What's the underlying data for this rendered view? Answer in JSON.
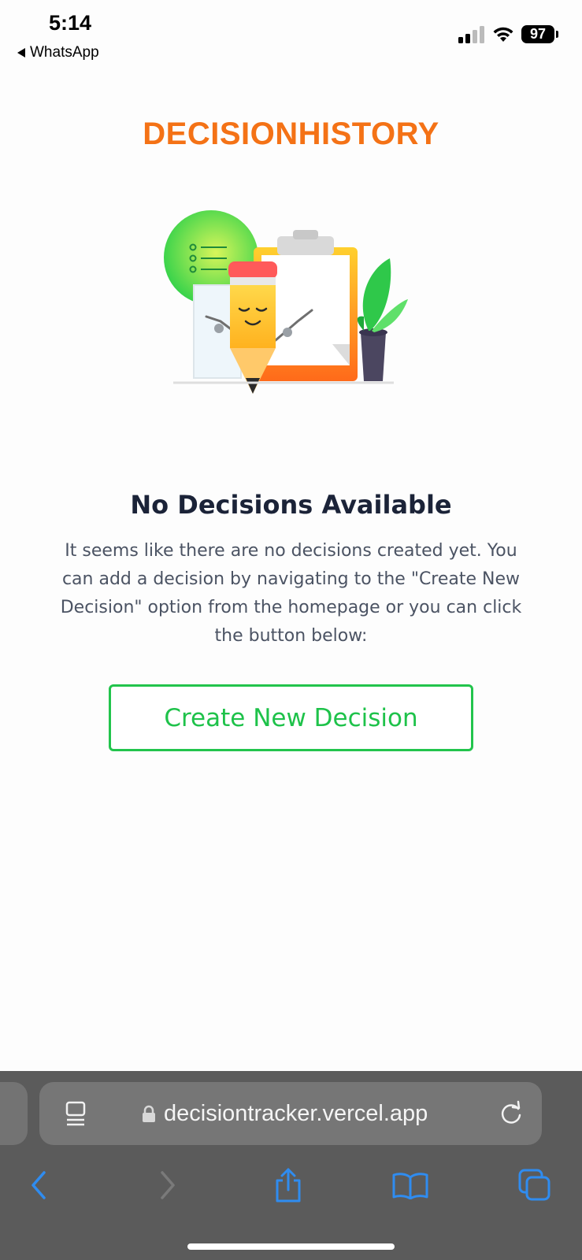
{
  "status_bar": {
    "time": "5:14",
    "back_app": "WhatsApp",
    "battery_level": "97"
  },
  "header": {
    "brand": "DECISIONHISTORY",
    "brand_color": "#f47216"
  },
  "empty_state": {
    "title": "No Decisions Available",
    "description": "It seems like there are no decisions created yet. You can add a decision by navigating to the \"Create New Decision\" option from the homepage or you can click the button below:",
    "button_label": "Create New Decision",
    "button_color": "#22c44c",
    "illustration": "pencil-clipboard-illustration"
  },
  "browser": {
    "url": "decisiontracker.vercel.app",
    "icons": [
      "reader-icon",
      "lock-icon",
      "reload-icon",
      "back-icon",
      "forward-icon",
      "share-icon",
      "bookmarks-icon",
      "tabs-icon"
    ]
  }
}
